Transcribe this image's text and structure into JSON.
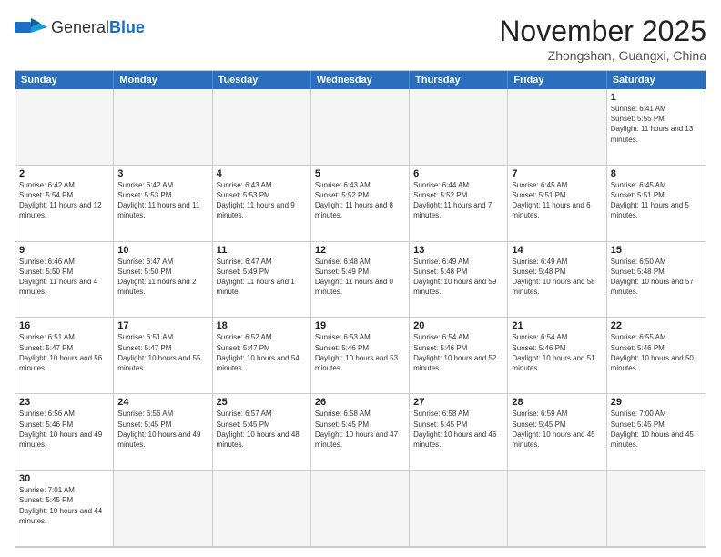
{
  "header": {
    "logo_general": "General",
    "logo_blue": "Blue",
    "month_title": "November 2025",
    "location": "Zhongshan, Guangxi, China"
  },
  "day_headers": [
    "Sunday",
    "Monday",
    "Tuesday",
    "Wednesday",
    "Thursday",
    "Friday",
    "Saturday"
  ],
  "cells": [
    {
      "date": "",
      "info": "",
      "empty": true
    },
    {
      "date": "",
      "info": "",
      "empty": true
    },
    {
      "date": "",
      "info": "",
      "empty": true
    },
    {
      "date": "",
      "info": "",
      "empty": true
    },
    {
      "date": "",
      "info": "",
      "empty": true
    },
    {
      "date": "",
      "info": "",
      "empty": true
    },
    {
      "date": "1",
      "info": "Sunrise: 6:41 AM\nSunset: 5:55 PM\nDaylight: 11 hours and 13 minutes."
    },
    {
      "date": "2",
      "info": "Sunrise: 6:42 AM\nSunset: 5:54 PM\nDaylight: 11 hours and 12 minutes."
    },
    {
      "date": "3",
      "info": "Sunrise: 6:42 AM\nSunset: 5:53 PM\nDaylight: 11 hours and 11 minutes."
    },
    {
      "date": "4",
      "info": "Sunrise: 6:43 AM\nSunset: 5:53 PM\nDaylight: 11 hours and 9 minutes."
    },
    {
      "date": "5",
      "info": "Sunrise: 6:43 AM\nSunset: 5:52 PM\nDaylight: 11 hours and 8 minutes."
    },
    {
      "date": "6",
      "info": "Sunrise: 6:44 AM\nSunset: 5:52 PM\nDaylight: 11 hours and 7 minutes."
    },
    {
      "date": "7",
      "info": "Sunrise: 6:45 AM\nSunset: 5:51 PM\nDaylight: 11 hours and 6 minutes."
    },
    {
      "date": "8",
      "info": "Sunrise: 6:45 AM\nSunset: 5:51 PM\nDaylight: 11 hours and 5 minutes."
    },
    {
      "date": "9",
      "info": "Sunrise: 6:46 AM\nSunset: 5:50 PM\nDaylight: 11 hours and 4 minutes."
    },
    {
      "date": "10",
      "info": "Sunrise: 6:47 AM\nSunset: 5:50 PM\nDaylight: 11 hours and 2 minutes."
    },
    {
      "date": "11",
      "info": "Sunrise: 6:47 AM\nSunset: 5:49 PM\nDaylight: 11 hours and 1 minute."
    },
    {
      "date": "12",
      "info": "Sunrise: 6:48 AM\nSunset: 5:49 PM\nDaylight: 11 hours and 0 minutes."
    },
    {
      "date": "13",
      "info": "Sunrise: 6:49 AM\nSunset: 5:48 PM\nDaylight: 10 hours and 59 minutes."
    },
    {
      "date": "14",
      "info": "Sunrise: 6:49 AM\nSunset: 5:48 PM\nDaylight: 10 hours and 58 minutes."
    },
    {
      "date": "15",
      "info": "Sunrise: 6:50 AM\nSunset: 5:48 PM\nDaylight: 10 hours and 57 minutes."
    },
    {
      "date": "16",
      "info": "Sunrise: 6:51 AM\nSunset: 5:47 PM\nDaylight: 10 hours and 56 minutes."
    },
    {
      "date": "17",
      "info": "Sunrise: 6:51 AM\nSunset: 5:47 PM\nDaylight: 10 hours and 55 minutes."
    },
    {
      "date": "18",
      "info": "Sunrise: 6:52 AM\nSunset: 5:47 PM\nDaylight: 10 hours and 54 minutes."
    },
    {
      "date": "19",
      "info": "Sunrise: 6:53 AM\nSunset: 5:46 PM\nDaylight: 10 hours and 53 minutes."
    },
    {
      "date": "20",
      "info": "Sunrise: 6:54 AM\nSunset: 5:46 PM\nDaylight: 10 hours and 52 minutes."
    },
    {
      "date": "21",
      "info": "Sunrise: 6:54 AM\nSunset: 5:46 PM\nDaylight: 10 hours and 51 minutes."
    },
    {
      "date": "22",
      "info": "Sunrise: 6:55 AM\nSunset: 5:46 PM\nDaylight: 10 hours and 50 minutes."
    },
    {
      "date": "23",
      "info": "Sunrise: 6:56 AM\nSunset: 5:46 PM\nDaylight: 10 hours and 49 minutes."
    },
    {
      "date": "24",
      "info": "Sunrise: 6:56 AM\nSunset: 5:45 PM\nDaylight: 10 hours and 49 minutes."
    },
    {
      "date": "25",
      "info": "Sunrise: 6:57 AM\nSunset: 5:45 PM\nDaylight: 10 hours and 48 minutes."
    },
    {
      "date": "26",
      "info": "Sunrise: 6:58 AM\nSunset: 5:45 PM\nDaylight: 10 hours and 47 minutes."
    },
    {
      "date": "27",
      "info": "Sunrise: 6:58 AM\nSunset: 5:45 PM\nDaylight: 10 hours and 46 minutes."
    },
    {
      "date": "28",
      "info": "Sunrise: 6:59 AM\nSunset: 5:45 PM\nDaylight: 10 hours and 45 minutes."
    },
    {
      "date": "29",
      "info": "Sunrise: 7:00 AM\nSunset: 5:45 PM\nDaylight: 10 hours and 45 minutes."
    },
    {
      "date": "30",
      "info": "Sunrise: 7:01 AM\nSunset: 5:45 PM\nDaylight: 10 hours and 44 minutes."
    },
    {
      "date": "",
      "info": "",
      "empty": true
    },
    {
      "date": "",
      "info": "",
      "empty": true
    },
    {
      "date": "",
      "info": "",
      "empty": true
    },
    {
      "date": "",
      "info": "",
      "empty": true
    },
    {
      "date": "",
      "info": "",
      "empty": true
    },
    {
      "date": "",
      "info": "",
      "empty": true
    }
  ]
}
